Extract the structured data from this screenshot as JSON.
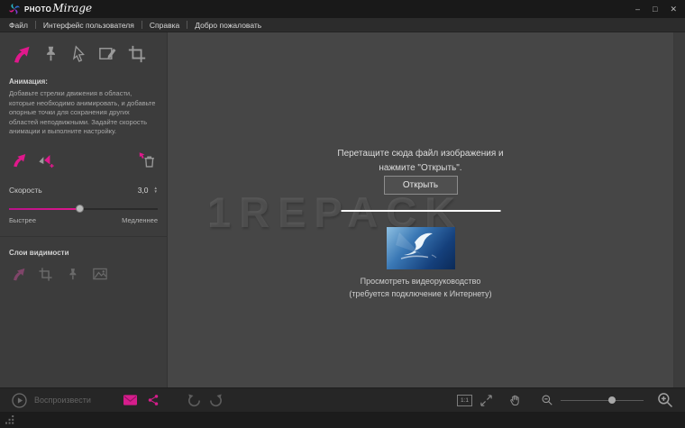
{
  "titlebar": {
    "brand_photo": "PHOTO",
    "brand_mirage": "Mirage"
  },
  "icons": {
    "minimize": "–",
    "maximize": "□",
    "close": "✕",
    "spinner_up": "▲",
    "spinner_down": "▼",
    "actual_size": "1:1"
  },
  "menu": {
    "items": [
      "Файл",
      "Интерфейс пользователя",
      "Справка",
      "Добро пожаловать"
    ]
  },
  "sidebar": {
    "animation_title": "Анимация:",
    "animation_description": "Добавьте стрелки движения в области, которые необходимо анимировать, и добавьте опорные точки для сохранения других областей неподвижными. Задайте скорость анимации и выполните настройку.",
    "speed_label": "Скорость",
    "speed_value": "3,0",
    "faster": "Быстрее",
    "slower": "Медленнее",
    "layers_title": "Слои видимости"
  },
  "canvas": {
    "watermark": "1REPACK",
    "drop_line1": "Перетащите сюда файл изображения и",
    "drop_line2": "нажмите \"Открыть\".",
    "open_button": "Открыть",
    "tutorial_line1": "Просмотреть видеоруководство",
    "tutorial_line2": "(требуется подключение к Интернету)"
  },
  "toolbar": {
    "play_label": "Воспроизвести"
  },
  "colors": {
    "accent_magenta": "#e0188c",
    "canvas_bg": "#464646",
    "panel_bg": "#3c3c3c",
    "titlebar_bg": "#191919"
  }
}
